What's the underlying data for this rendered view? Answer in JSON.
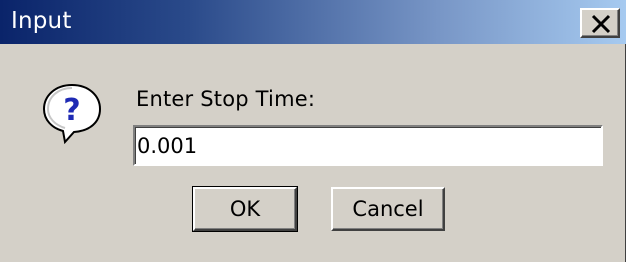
{
  "window": {
    "title": "Input",
    "close_icon": "close-icon"
  },
  "dialog": {
    "icon": "question-icon",
    "prompt": "Enter Stop Time:",
    "input_value": "0.001"
  },
  "buttons": {
    "ok_label": "OK",
    "cancel_label": "Cancel"
  },
  "colors": {
    "title_gradient_start": "#0a246a",
    "title_gradient_end": "#a6caf0",
    "dialog_background": "#d4d0c8"
  }
}
